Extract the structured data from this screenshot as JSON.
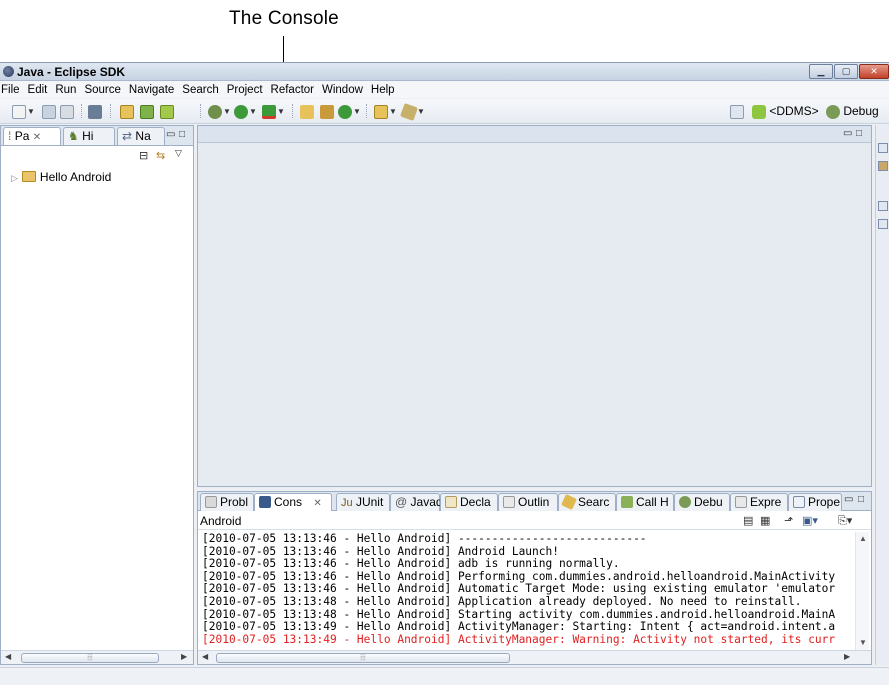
{
  "callout": {
    "label": "The Console"
  },
  "window": {
    "title": "Java - Eclipse SDK"
  },
  "menu": {
    "items": [
      "File",
      "Edit",
      "Run",
      "Source",
      "Navigate",
      "Search",
      "Project",
      "Refactor",
      "Window",
      "Help"
    ]
  },
  "toolbar": {
    "ddms_label": "<DDMS>",
    "debug_label": "Debug"
  },
  "left_panel": {
    "tabs": [
      "Pa",
      "Hi",
      "Na"
    ],
    "tree": {
      "project": "Hello Android"
    }
  },
  "console_view": {
    "tabs": [
      "Probl",
      "Cons",
      "JUnit",
      "Javad",
      "Decla",
      "Outlin",
      "Searc",
      "Call H",
      "Debu",
      "Expre",
      "Prope"
    ],
    "header": "Android",
    "lines": [
      {
        "text": "[2010-07-05 13:13:46 - Hello Android] ----------------------------",
        "error": false
      },
      {
        "text": "[2010-07-05 13:13:46 - Hello Android] Android Launch!",
        "error": false
      },
      {
        "text": "[2010-07-05 13:13:46 - Hello Android] adb is running normally.",
        "error": false
      },
      {
        "text": "[2010-07-05 13:13:46 - Hello Android] Performing com.dummies.android.helloandroid.MainActivity",
        "error": false
      },
      {
        "text": "[2010-07-05 13:13:46 - Hello Android] Automatic Target Mode: using existing emulator 'emulator",
        "error": false
      },
      {
        "text": "[2010-07-05 13:13:48 - Hello Android] Application already deployed. No need to reinstall.",
        "error": false
      },
      {
        "text": "[2010-07-05 13:13:48 - Hello Android] Starting activity com.dummies.android.helloandroid.MainA",
        "error": false
      },
      {
        "text": "[2010-07-05 13:13:49 - Hello Android] ActivityManager: Starting: Intent { act=android.intent.a",
        "error": false
      },
      {
        "text": "[2010-07-05 13:13:49 - Hello Android] ActivityManager: Warning: Activity not started, its curr",
        "error": true
      }
    ]
  },
  "colors": {
    "error_text": "#e02020",
    "frame": "#9fb0c6"
  },
  "icons": [
    "minimize-icon",
    "maximize-icon",
    "close-icon",
    "new-icon",
    "save-icon",
    "print-icon",
    "debug-icon",
    "run-icon",
    "folder-icon",
    "console-icon"
  ]
}
